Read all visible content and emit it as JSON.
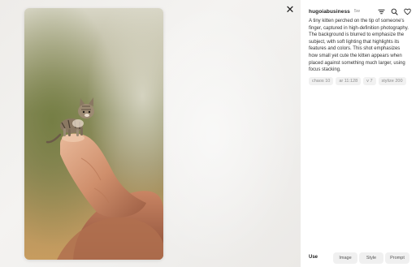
{
  "close": {
    "icon": "close-icon"
  },
  "image": {
    "subject": "kitten-on-finger"
  },
  "post": {
    "username": "hugoiabusiness",
    "time_ago": "5w",
    "icons": [
      "filter-icon",
      "search-icon",
      "heart-icon"
    ],
    "description": "A tiny kitten perched on the tip of someone's finger, captured in high-definition photography. The background is blurred to emphasize the subject, with soft lighting that highlights its features and colors. This shot emphasizes how small yet cute the kitten appears when placed against something much larger, using focus stacking.",
    "params": [
      "chaos 10",
      "ar 11:128",
      "v 7",
      "stylize 200"
    ]
  },
  "footer": {
    "use_label": "Use",
    "buttons": [
      "Image",
      "Style",
      "Prompt"
    ]
  }
}
